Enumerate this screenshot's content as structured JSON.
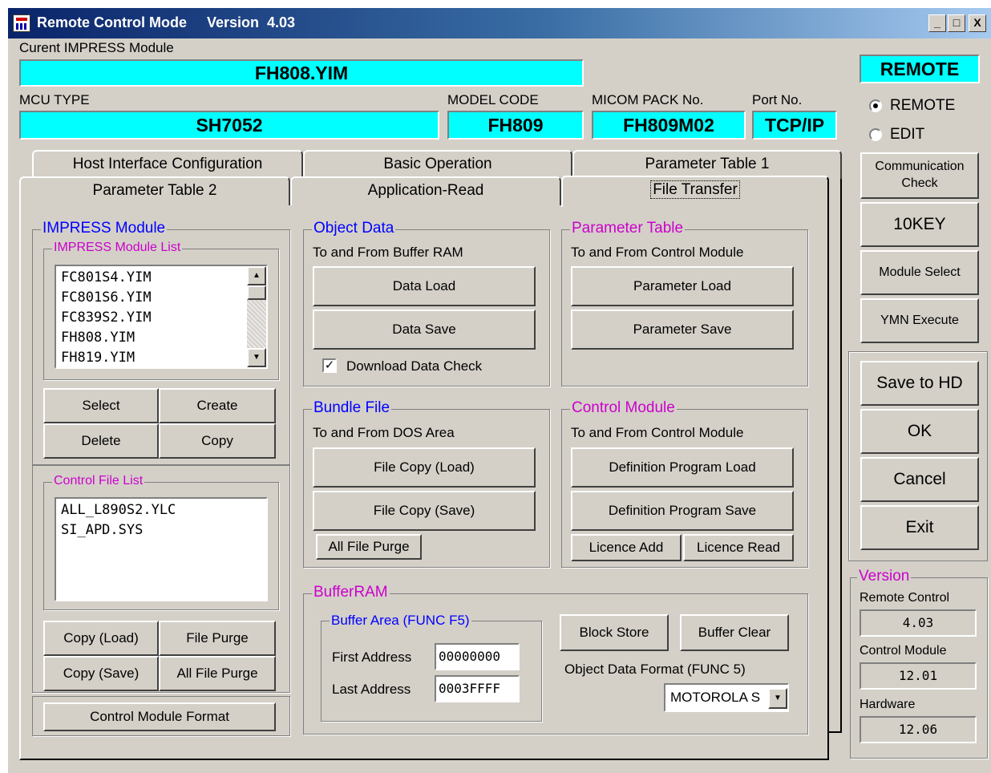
{
  "window": {
    "title": "Remote Control Mode     Version  4.03",
    "minimize": "_",
    "maximize": "□",
    "close": "X"
  },
  "header": {
    "current_module_label": "Curent IMPRESS Module",
    "current_module_value": "FH808.YIM",
    "mcu_type_label": "MCU TYPE",
    "mcu_type_value": "SH7052",
    "model_code_label": "MODEL CODE",
    "model_code_value": "FH809",
    "micom_pack_label": "MICOM PACK No.",
    "micom_pack_value": "FH809M02",
    "port_label": "Port No.",
    "port_value": "TCP/IP"
  },
  "right_panel": {
    "mode_badge": "REMOTE",
    "radio_remote": "REMOTE",
    "radio_edit": "EDIT",
    "selected_mode": "REMOTE",
    "communication_check": "Communication Check",
    "tenkey": "10KEY",
    "module_select": "Module Select",
    "ymn_execute": "YMN Execute",
    "save_to_hd": "Save to HD",
    "ok": "OK",
    "cancel": "Cancel",
    "exit": "Exit",
    "version_title": "Version",
    "remote_control_label": "Remote Control",
    "remote_control_value": "4.03",
    "control_module_label": "Control Module",
    "control_module_value": "12.01",
    "hardware_label": "Hardware",
    "hardware_value": "12.06"
  },
  "tabs": {
    "row_back": [
      "Host Interface Configuration",
      "Basic Operation",
      "Parameter Table 1"
    ],
    "row_front": [
      "Parameter Table 2",
      "Application-Read",
      "File Transfer"
    ],
    "active": "File Transfer"
  },
  "impress": {
    "title": "IMPRESS Module",
    "list_title": "IMPRESS Module List",
    "list": [
      "FC801S4.YIM",
      "FC801S6.YIM",
      "FC839S2.YIM",
      "FH808.YIM",
      "FH819.YIM"
    ],
    "select": "Select",
    "create": "Create",
    "delete": "Delete",
    "copy": "Copy"
  },
  "control_file": {
    "title": "Control File List",
    "list": [
      "ALL_L890S2.YLC",
      "SI_APD.SYS"
    ],
    "copy_load": "Copy (Load)",
    "file_purge": "File Purge",
    "copy_save": "Copy (Save)",
    "all_file_purge": "All File Purge",
    "control_module_format": "Control Module Format"
  },
  "object_data": {
    "title": "Object Data",
    "subtitle": "To and From Buffer RAM",
    "data_load": "Data Load",
    "data_save": "Data Save",
    "download_check": "Download Data Check",
    "download_checked": "✓"
  },
  "parameter_table": {
    "title": "Parameter Table",
    "subtitle": "To and From Control Module",
    "parameter_load": "Parameter Load",
    "parameter_save": "Parameter Save"
  },
  "bundle_file": {
    "title": "Bundle File",
    "subtitle": "To and From DOS Area",
    "file_copy_load": "File Copy (Load)",
    "file_copy_save": "File Copy (Save)",
    "all_file_purge": "All File Purge"
  },
  "control_module": {
    "title": "Control Module",
    "subtitle": "To and From Control Module",
    "def_load": "Definition Program Load",
    "def_save": "Definition Program Save",
    "licence_add": "Licence Add",
    "licence_read": "Licence Read"
  },
  "buffer_ram": {
    "title": "BufferRAM",
    "area_title": "Buffer Area (FUNC F5)",
    "first_label": "First Address",
    "first_value": "00000000",
    "last_label": "Last Address",
    "last_value": "0003FFFF",
    "block_store": "Block Store",
    "buffer_clear": "Buffer Clear",
    "format_label": "Object Data Format (FUNC 5)",
    "format_value": "MOTOROLA S"
  },
  "icons": {
    "scroll_up": "▲",
    "scroll_down": "▼",
    "dropdown": "▼"
  }
}
